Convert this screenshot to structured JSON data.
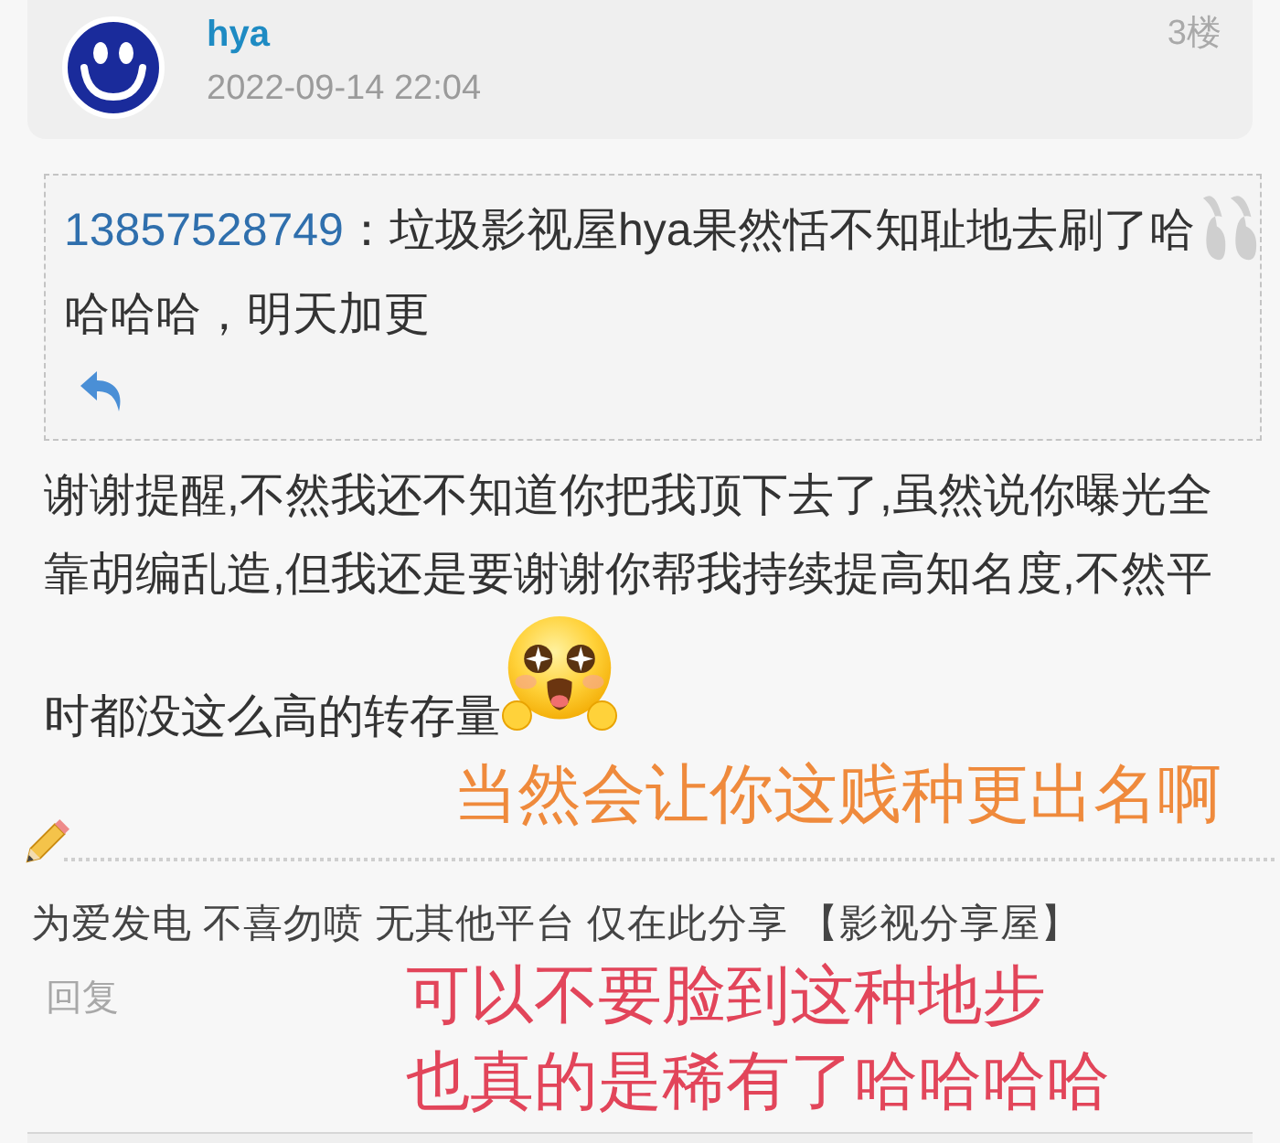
{
  "post_header": {
    "username": "hya",
    "timestamp": "2022-09-14 22:04",
    "floor": "3楼"
  },
  "quote": {
    "author": "13857528749",
    "text": "：垃圾影视屋hya果然恬不知耻地去刷了哈哈哈哈，明天加更"
  },
  "body": {
    "text": "谢谢提醒,不然我还不知道你把我顶下去了,虽然说你曝光全靠胡编乱造,但我还是要谢谢你帮我持续提高知名度,不然平时都没这么高的转存量"
  },
  "annotations": [
    {
      "lines": [
        "当然会让你这贱种更出名啊"
      ],
      "color": "#ef8a3c"
    },
    {
      "lines": [
        "可以不要脸到这种地步",
        "也真的是稀有了哈哈哈哈"
      ],
      "color": "#e2455a"
    }
  ],
  "signature": "为爱发电 不喜勿喷 无其他平台 仅在此分享 【影视分享屋】",
  "reply_link": "回复"
}
